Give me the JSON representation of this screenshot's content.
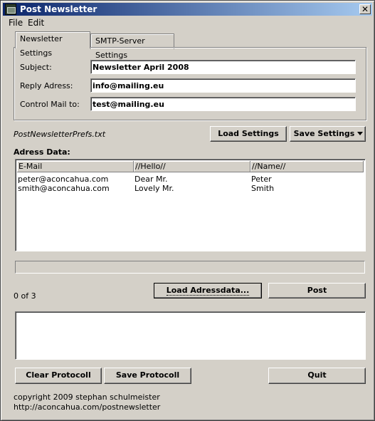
{
  "window": {
    "title": "Post Newsletter",
    "close_symbol": "✕"
  },
  "menu": {
    "items": [
      "File",
      "Edit"
    ]
  },
  "tabs": [
    {
      "label": "Newsletter Settings",
      "active": true
    },
    {
      "label": "SMTP-Server Settings",
      "active": false
    }
  ],
  "settings": {
    "subject_label": "Subject:",
    "subject_value": "Newsletter April 2008",
    "reply_label": "Reply Adress:",
    "reply_value": "info@mailing.eu",
    "control_label": "Control Mail to:",
    "control_value": "test@mailing.eu"
  },
  "prefs_file": "PostNewsletterPrefs.txt",
  "buttons": {
    "load_settings": "Load Settings",
    "save_settings": "Save Settings",
    "load_adressdata": "Load Adressdata...",
    "post": "Post",
    "clear_protocoll": "Clear Protocoll",
    "save_protocoll": "Save Protocoll",
    "quit": "Quit"
  },
  "address": {
    "title": "Adress Data:",
    "columns": [
      "E-Mail",
      "//Hello//",
      "//Name//"
    ],
    "rows": [
      [
        "peter@aconcahua.com",
        "Dear Mr.",
        "Peter"
      ],
      [
        "smith@aconcahua.com",
        "Lovely Mr.",
        "Smith"
      ]
    ]
  },
  "progress": {
    "text": "0 of 3",
    "value": 0
  },
  "footer": {
    "copyright": "copyright 2009 stephan schulmeister",
    "url": "http://aconcahua.com/postnewsletter"
  }
}
